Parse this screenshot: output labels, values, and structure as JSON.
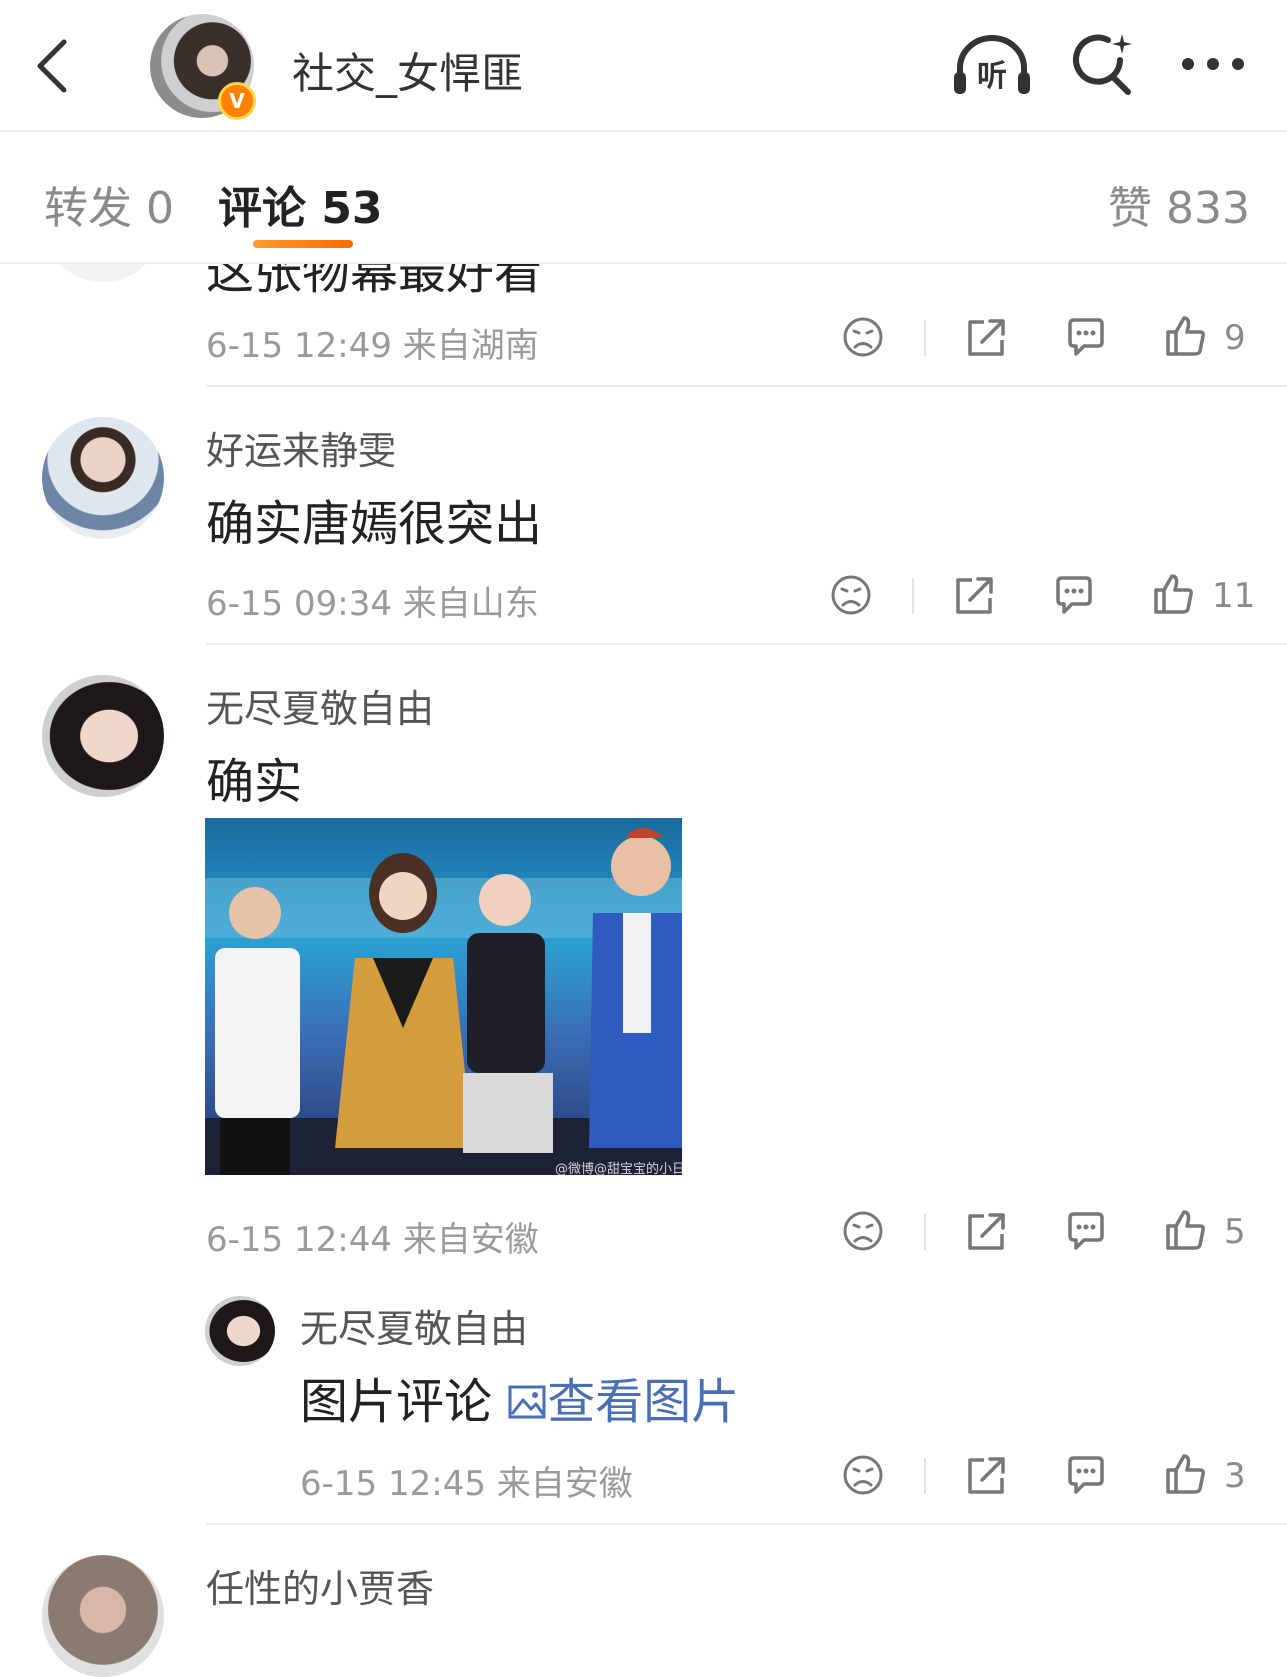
{
  "header": {
    "title": "社交_女悍匪",
    "listen_label": "听",
    "verified_badge": "V",
    "accent": "#ff8200"
  },
  "tabs": {
    "repost": "转发 0",
    "comments": "评论 53",
    "likes": "赞 833"
  },
  "partial_top_comment": {
    "text": "这张物幕最好看",
    "meta": "6-15 12:49  来自湖南",
    "likes": "9"
  },
  "comments": [
    {
      "user": "好运来静雯",
      "text": "确实唐嫣很突出",
      "meta": "6-15 09:34  来自山东",
      "likes": "11"
    },
    {
      "user": "无尽夏敬自由",
      "text": "确实",
      "photo_watermark": "@微博@甜宝宝的小日记",
      "meta": "6-15 12:44  来自安徽",
      "likes": "5"
    }
  ],
  "reply": {
    "user": "无尽夏敬自由",
    "text": "图片评论",
    "link": "查看图片",
    "meta": "6-15 12:45  来自安徽",
    "likes": "3"
  },
  "partial_bottom_user": "任性的小贾香"
}
